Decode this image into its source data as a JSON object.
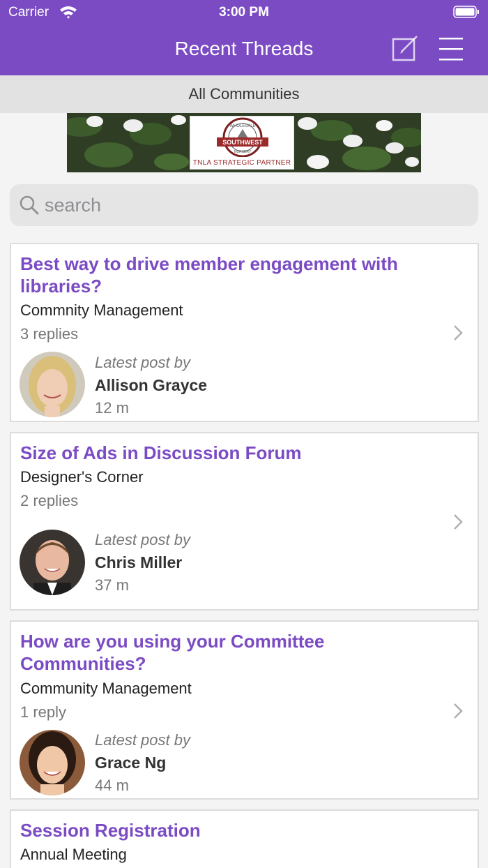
{
  "status": {
    "carrier": "Carrier",
    "time": "3:00 PM"
  },
  "nav": {
    "title": "Recent Threads"
  },
  "filter": {
    "label": "All Communities"
  },
  "banner": {
    "logo_top": "WHOLESALE",
    "logo_main": "SOUTHWEST",
    "logo_bottom": "NURSERY",
    "tagline": "TNLA STRATEGIC PARTNER"
  },
  "search": {
    "placeholder": "search",
    "value": ""
  },
  "latest_label": "Latest post by",
  "threads": [
    {
      "title": "Best way to drive member engagement with libraries?",
      "community": "Commnity Management",
      "replies": "3 replies",
      "author": "Allison Grayce",
      "ago": "12 m"
    },
    {
      "title": "Size of Ads in Discussion Forum",
      "community": "Designer's Corner",
      "replies": "2 replies",
      "author": "Chris Miller",
      "ago": "37 m"
    },
    {
      "title": "How are you using your Committee Communities?",
      "community": "Community Management",
      "replies": "1 reply",
      "author": "Grace Ng",
      "ago": "44 m"
    },
    {
      "title": "Session Registration",
      "community": "Annual Meeting"
    }
  ],
  "colors": {
    "accent": "#7b4bc4",
    "subbar": "#e2e2e2",
    "background": "#f4f4f4"
  }
}
